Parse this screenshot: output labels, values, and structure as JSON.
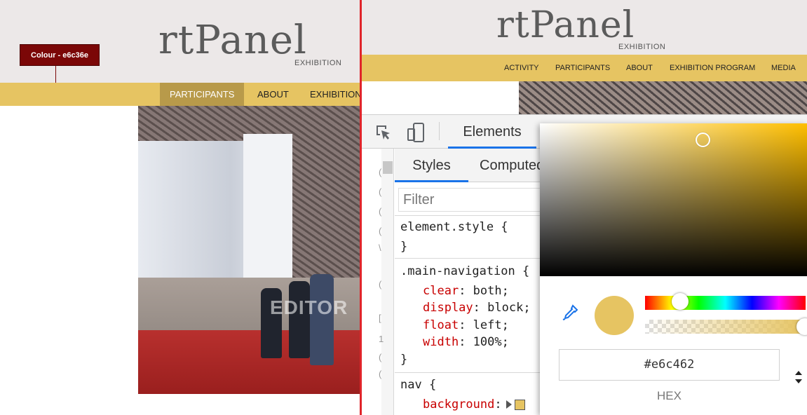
{
  "left": {
    "logo": "rtPanel",
    "logo_sub": "EXHIBITION",
    "tooltip": "Colour - e6c36e",
    "nav": [
      "PARTICIPANTS",
      "ABOUT",
      "EXHIBITION"
    ],
    "watermark": "EDITOR"
  },
  "right": {
    "logo": "rtPanel",
    "logo_sub": "EXHIBITION",
    "nav": [
      "ACTIVITY",
      "PARTICIPANTS",
      "ABOUT",
      "EXHIBITION PROGRAM",
      "MEDIA"
    ]
  },
  "devtools": {
    "main_tab": "Elements",
    "subtabs": [
      "Styles",
      "Computed"
    ],
    "filter_placeholder": "Filter",
    "rules": {
      "element_style_open": "element.style {",
      "element_style_close": "}",
      "main_nav_selector": ".main-navigation {",
      "main_nav_props": [
        {
          "name": "clear",
          "value": "both;"
        },
        {
          "name": "display",
          "value": "block;"
        },
        {
          "name": "float",
          "value": "left;"
        },
        {
          "name": "width",
          "value": "100%;"
        }
      ],
      "main_nav_close": "}",
      "nav_selector": "nav {",
      "nav_prop": {
        "name": "background",
        "value": ":"
      }
    },
    "gutter_chars": [
      "(",
      "(",
      "(",
      "(",
      "\\",
      "(",
      "[",
      "1",
      "(",
      "("
    ]
  },
  "color_picker": {
    "hex_value": "#e6c462",
    "format_label": "HEX"
  },
  "colors": {
    "accent_gold": "#e6c462",
    "nav_active": "#b89a4a",
    "tooltip_bg": "#7b0707",
    "divider": "#e0242a",
    "devtools_blue": "#1a73e8"
  }
}
